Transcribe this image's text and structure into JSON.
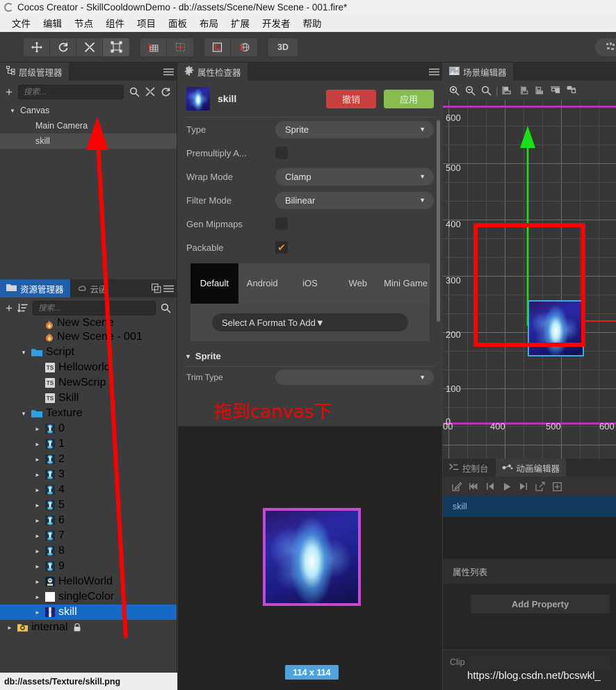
{
  "window": {
    "title": "Cocos Creator - SkillCooldownDemo - db://assets/Scene/New Scene - 001.fire*",
    "logo_icon": "cocos-logo-icon"
  },
  "menubar": {
    "items": [
      "文件",
      "编辑",
      "节点",
      "组件",
      "项目",
      "面板",
      "布局",
      "扩展",
      "开发者",
      "帮助"
    ]
  },
  "toolbar": {
    "transform_tools": [
      {
        "name": "move-tool",
        "icon": "move-icon"
      },
      {
        "name": "rotate-tool",
        "icon": "rotate-icon"
      },
      {
        "name": "scale-tool",
        "icon": "scale-icon"
      },
      {
        "name": "rect-tool",
        "icon": "rect-transform-icon"
      }
    ],
    "pivot_tools": [
      {
        "name": "pivot-toggle",
        "icon": "pivot-icon"
      },
      {
        "name": "anchor-toggle",
        "icon": "anchor-icon"
      }
    ],
    "coord_tools": [
      {
        "name": "local-coord-toggle",
        "icon": "local-axis-icon"
      },
      {
        "name": "global-coord-toggle",
        "icon": "global-axis-icon"
      }
    ],
    "mode_3d_label": "3D"
  },
  "hierarchy": {
    "tab_label": "层级管理器",
    "tab_icon": "hierarchy-icon",
    "menu_icon": "hamburger-icon",
    "add_icon": "plus-icon",
    "search": {
      "placeholder": "搜索...",
      "value": ""
    },
    "tool_icons": [
      "search-icon",
      "collapse-icon",
      "refresh-icon"
    ],
    "nodes": [
      {
        "label": "Canvas",
        "depth": 0,
        "expanded": true,
        "selected": false
      },
      {
        "label": "Main Camera",
        "depth": 1,
        "expanded": false,
        "selected": false
      },
      {
        "label": "skill",
        "depth": 1,
        "expanded": false,
        "selected": true
      }
    ]
  },
  "assets": {
    "tabs": [
      {
        "label": "资源管理器",
        "icon": "folder-icon",
        "active": true
      },
      {
        "label": "云函",
        "icon": "cloud-icon",
        "active": false
      }
    ],
    "copy_icon": "copy-icon",
    "menu_icon": "hamburger-icon",
    "add_icon": "plus-icon",
    "sort_icon": "sort-icon",
    "search": {
      "placeholder": "搜索...",
      "value": ""
    },
    "search_icon": "search-icon",
    "items": [
      {
        "label": "New Scene",
        "depth": 2,
        "icon": "fire-icon",
        "partial": true,
        "selected": false,
        "caret": ""
      },
      {
        "label": "New Scene - 001",
        "depth": 2,
        "icon": "fire-icon",
        "selected": false,
        "caret": ""
      },
      {
        "label": "Script",
        "depth": 1,
        "icon": "folder-icon",
        "selected": false,
        "caret": "down"
      },
      {
        "label": "Helloworld",
        "depth": 2,
        "icon": "ts-icon",
        "selected": false,
        "caret": ""
      },
      {
        "label": "NewScrip",
        "depth": 2,
        "icon": "ts-icon",
        "selected": false,
        "caret": ""
      },
      {
        "label": "Skill",
        "depth": 2,
        "icon": "ts-icon",
        "selected": false,
        "caret": ""
      },
      {
        "label": "Texture",
        "depth": 1,
        "icon": "folder-icon",
        "selected": false,
        "caret": "down"
      },
      {
        "label": "0",
        "depth": 2,
        "icon": "texture-icon",
        "selected": false,
        "caret": "right"
      },
      {
        "label": "1",
        "depth": 2,
        "icon": "texture-icon",
        "selected": false,
        "caret": "right"
      },
      {
        "label": "2",
        "depth": 2,
        "icon": "texture-icon",
        "selected": false,
        "caret": "right"
      },
      {
        "label": "3",
        "depth": 2,
        "icon": "texture-icon",
        "selected": false,
        "caret": "right"
      },
      {
        "label": "4",
        "depth": 2,
        "icon": "texture-icon",
        "selected": false,
        "caret": "right"
      },
      {
        "label": "5",
        "depth": 2,
        "icon": "texture-icon",
        "selected": false,
        "caret": "right"
      },
      {
        "label": "6",
        "depth": 2,
        "icon": "texture-icon",
        "selected": false,
        "caret": "right"
      },
      {
        "label": "7",
        "depth": 2,
        "icon": "texture-icon",
        "selected": false,
        "caret": "right"
      },
      {
        "label": "8",
        "depth": 2,
        "icon": "texture-icon",
        "selected": false,
        "caret": "right"
      },
      {
        "label": "9",
        "depth": 2,
        "icon": "texture-icon",
        "selected": false,
        "caret": "right"
      },
      {
        "label": "HelloWorld",
        "depth": 2,
        "icon": "helloworld-icon",
        "selected": false,
        "caret": "right"
      },
      {
        "label": "singleColor",
        "depth": 2,
        "icon": "white-icon",
        "selected": false,
        "caret": "right"
      },
      {
        "label": "skill",
        "depth": 2,
        "icon": "skill-icon",
        "selected": true,
        "caret": "right"
      },
      {
        "label": "internal",
        "depth": 0,
        "icon": "internal-icon",
        "selected": false,
        "caret": "right",
        "lock": "lock-icon"
      }
    ],
    "status_path": "db://assets/Texture/skill.png"
  },
  "inspector": {
    "tab_label": "属性检查器",
    "tab_icon": "gear-icon",
    "menu_icon": "hamburger-icon",
    "asset_name": "skill",
    "asset_thumb_icon": "skill-thumb-icon",
    "undo_label": "撤销",
    "apply_label": "应用",
    "properties": [
      {
        "label": "Type",
        "type": "select",
        "value": "Sprite"
      },
      {
        "label": "Premultiply A...",
        "type": "checkbox",
        "checked": false
      },
      {
        "label": "Wrap Mode",
        "type": "select",
        "value": "Clamp"
      },
      {
        "label": "Filter Mode",
        "type": "select",
        "value": "Bilinear"
      },
      {
        "label": "Gen Mipmaps",
        "type": "checkbox",
        "checked": false
      },
      {
        "label": "Packable",
        "type": "checkbox",
        "checked": true
      }
    ],
    "platform_tabs": [
      {
        "label": "Default",
        "active": true
      },
      {
        "label": "Android",
        "active": false
      },
      {
        "label": "iOS",
        "active": false
      },
      {
        "label": "Web",
        "active": false
      },
      {
        "label": "Mini Game",
        "active": false
      }
    ],
    "format_select": {
      "value": "Select A Format To Add"
    },
    "sprite_section": {
      "title": "Sprite",
      "expanded": true,
      "first_row_label": "Trim Type"
    }
  },
  "preview": {
    "size_badge": "114 x 114",
    "image_icon": "skill-texture-preview"
  },
  "scene": {
    "tab_label": "场景编辑器",
    "tab_icon": "scene-icon",
    "tools": [
      {
        "name": "zoom-in-icon"
      },
      {
        "name": "zoom-out-icon"
      },
      {
        "name": "zoom-fit-icon"
      },
      {
        "name": "align-left-icon"
      },
      {
        "name": "align-center-h-icon"
      },
      {
        "name": "align-right-icon"
      },
      {
        "name": "align-top-icon"
      },
      {
        "name": "align-middle-icon"
      }
    ],
    "y_axis_labels": [
      "600",
      "500",
      "400",
      "300",
      "200",
      "100",
      "0"
    ],
    "x_axis_labels": [
      "00",
      "400",
      "500",
      "600"
    ],
    "selection_icon": "selected-node-box",
    "gizmo_icon": "move-gizmo-arrow"
  },
  "bottom_panel": {
    "tabs": [
      {
        "label": "控制台",
        "icon": "console-icon",
        "active": false
      },
      {
        "label": "动画编辑器",
        "icon": "animation-icon",
        "active": true
      }
    ],
    "tool_icons": [
      "edit-icon",
      "skip-start-icon",
      "prev-frame-icon",
      "play-icon",
      "next-frame-icon",
      "open-external-icon",
      "add-clip-icon"
    ],
    "node_row": "skill",
    "property_list_label": "属性列表",
    "add_property_label": "Add Property",
    "clip_label": "Clip"
  },
  "annotations": {
    "drag_text": "拖到canvas下",
    "watermark": "https://blog.csdn.net/bcswkl_",
    "arrow_color": "#fe0000"
  }
}
